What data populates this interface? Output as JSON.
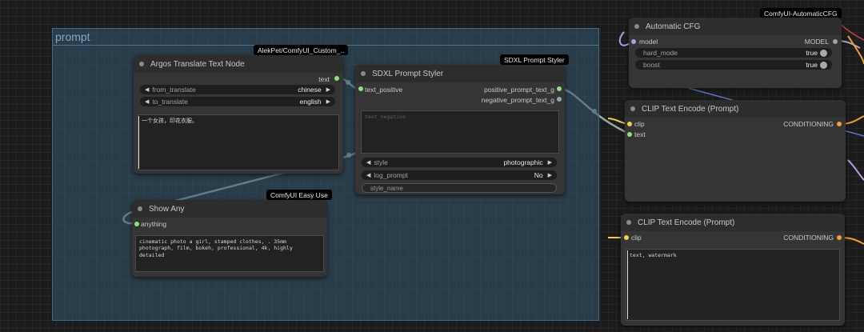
{
  "group": {
    "title": "prompt"
  },
  "colors": {
    "group_fill": "#355770",
    "node_bg": "#353535",
    "string_port": "#8ee07a",
    "clip_port": "#f0d04a",
    "conditioning_port": "#f0a030",
    "model_port": "#b39ddb",
    "link_grey": "#9aa6a0"
  },
  "top_right_badge": "ComfyUI-AutomaticCFG",
  "argos": {
    "badge": "AlekPet/ComfyUI_Custom_..",
    "title": "Argos Translate Text Node",
    "output": "text",
    "from_label": "from_translate",
    "from_value": "chinese",
    "to_label": "to_translate",
    "to_value": "english",
    "text": "一个女孩，印花衣服。"
  },
  "sdxl": {
    "badge": "SDXL Prompt Styler",
    "title": "SDXL Prompt Styler",
    "input": "text_positive",
    "output_pos": "positive_prompt_text_g",
    "output_neg": "negative_prompt_text_g",
    "placeholder": "text_negative",
    "style_label": "style",
    "style_value": "photographic",
    "log_label": "log_prompt",
    "log_value": "No",
    "name_placeholder": "style_name"
  },
  "showany": {
    "badge": "ComfyUI Easy Use",
    "title": "Show Any",
    "input": "anything",
    "text": "cinematic photo a girl, stamped clothes, . 35mm photograph, film, bokeh, professional, 4k, highly detailed"
  },
  "autocfg": {
    "title": "Automatic CFG",
    "input": "model",
    "output": "MODEL",
    "hard_label": "hard_mode",
    "hard_value": "true",
    "boost_label": "boost",
    "boost_value": "true"
  },
  "clip1": {
    "title": "CLIP Text Encode (Prompt)",
    "input_clip": "clip",
    "input_text": "text",
    "output": "CONDITIONING"
  },
  "clip2": {
    "title": "CLIP Text Encode (Prompt)",
    "input_clip": "clip",
    "output": "CONDITIONING",
    "text": "text, watermark"
  }
}
